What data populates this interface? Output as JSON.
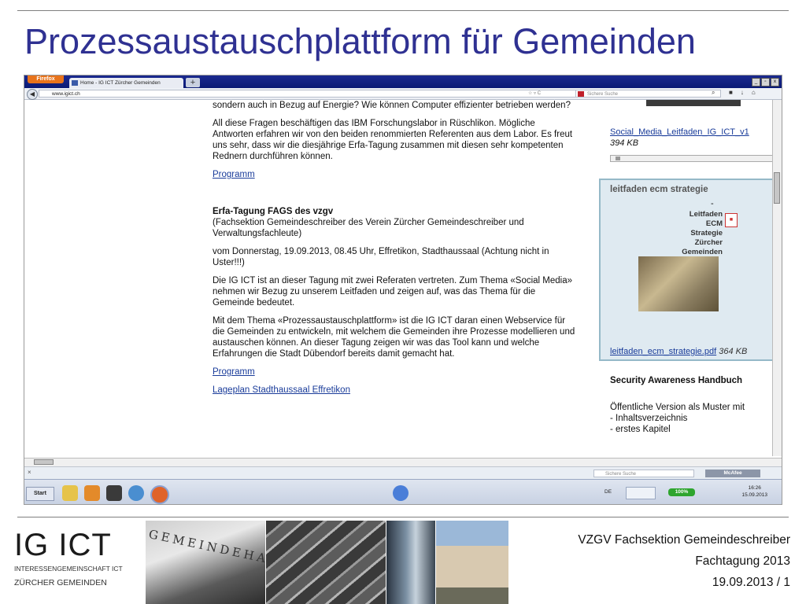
{
  "slide": {
    "title": "Prozessaustauschplattform für Gemeinden"
  },
  "browser": {
    "firefox_button": "Firefox",
    "tab_title": "Home - IG ICT Zürcher Gemeinden",
    "new_tab": "+",
    "url": "www.igict.ch",
    "url_controls": "☆ ▿ C",
    "search_placeholder": "Sichere Suche",
    "window_controls": [
      "_",
      "▫",
      "x"
    ]
  },
  "main": {
    "p1": "sondern auch in Bezug auf Energie? Wie können Computer effizienter betrieben werden?",
    "p2": "All diese Fragen beschäftigen das IBM Forschungslabor in Rüschlikon. Mögliche Antworten erfahren wir von den beiden renommierten Referenten aus dem Labor. Es freut uns sehr, dass wir die diesjährige Erfa-Tagung zusammen mit diesen sehr kompetenten Rednern durchführen können.",
    "link_programm_1": "Programm",
    "event_title": "Erfa-Tagung FAGS des vzgv",
    "event_subtitle": "(Fachsektion Gemeindeschreiber des Verein Zürcher Gemeindeschreiber und Verwaltungsfachleute)",
    "p3": "vom Donnerstag, 19.09.2013, 08.45 Uhr, Effretikon, Stadthaussaal (Achtung nicht in Uster!!!)",
    "p4": "Die IG ICT ist an dieser Tagung mit zwei Referaten vertreten. Zum Thema «Social Media» nehmen wir Bezug zu unserem Leitfaden und zeigen auf, was das Thema für die Gemeinde bedeutet.",
    "p5": "Mit dem Thema «Prozessaustauschplattform» ist die IG ICT daran einen Webservice für die Gemeinden zu entwickeln, mit welchem die Gemeinden ihre Prozesse modellieren und austauschen können. An dieser Tagung zeigen wir was das Tool kann und welche Erfahrungen die Stadt Dübendorf bereits damit gemacht hat.",
    "link_programm_2": "Programm",
    "link_lageplan": "Lageplan Stadthaussaal Effretikon"
  },
  "sidebar": {
    "social_link": "Social_Media_Leitfaden_IG_ICT_v1",
    "social_size": "394 KB",
    "ecm_title": "leitfaden ecm strategie",
    "ecm_dash": "-",
    "ecm_lines": [
      "Leitfaden",
      "ECM",
      "Strategie",
      "Zürcher",
      "Gemeinden"
    ],
    "ecm_link": "leitfaden_ecm_strategie.pdf",
    "ecm_size": "364 KB",
    "security_title": "Security Awareness Handbuch",
    "security_lines": [
      "Öffentliche Version als Muster mit",
      "- Inhaltsverzeichnis",
      "- erstes Kapitel"
    ]
  },
  "statusbar": {
    "search_placeholder": "Sichere Suche",
    "mcafee": "McAfee"
  },
  "taskbar": {
    "start": "Start",
    "language": "DE",
    "battery": "100%",
    "time": "16:26",
    "date": "15.09.2013"
  },
  "footer": {
    "logo": "IG ICT",
    "logo_sub1": "INTERESSENGEMEINSCHAFT ICT",
    "logo_sub2": "ZÜRCHER GEMEINDEN",
    "photo_text": "GEMEINDEHAUS",
    "line1": "VZGV Fachsektion Gemeindeschreiber",
    "line2": "Fachtagung 2013",
    "line3": "19.09.2013 / 1"
  },
  "colors": {
    "title": "#2f3192",
    "link": "#1a3c9a",
    "ecm_box": "#dfeaf1"
  }
}
